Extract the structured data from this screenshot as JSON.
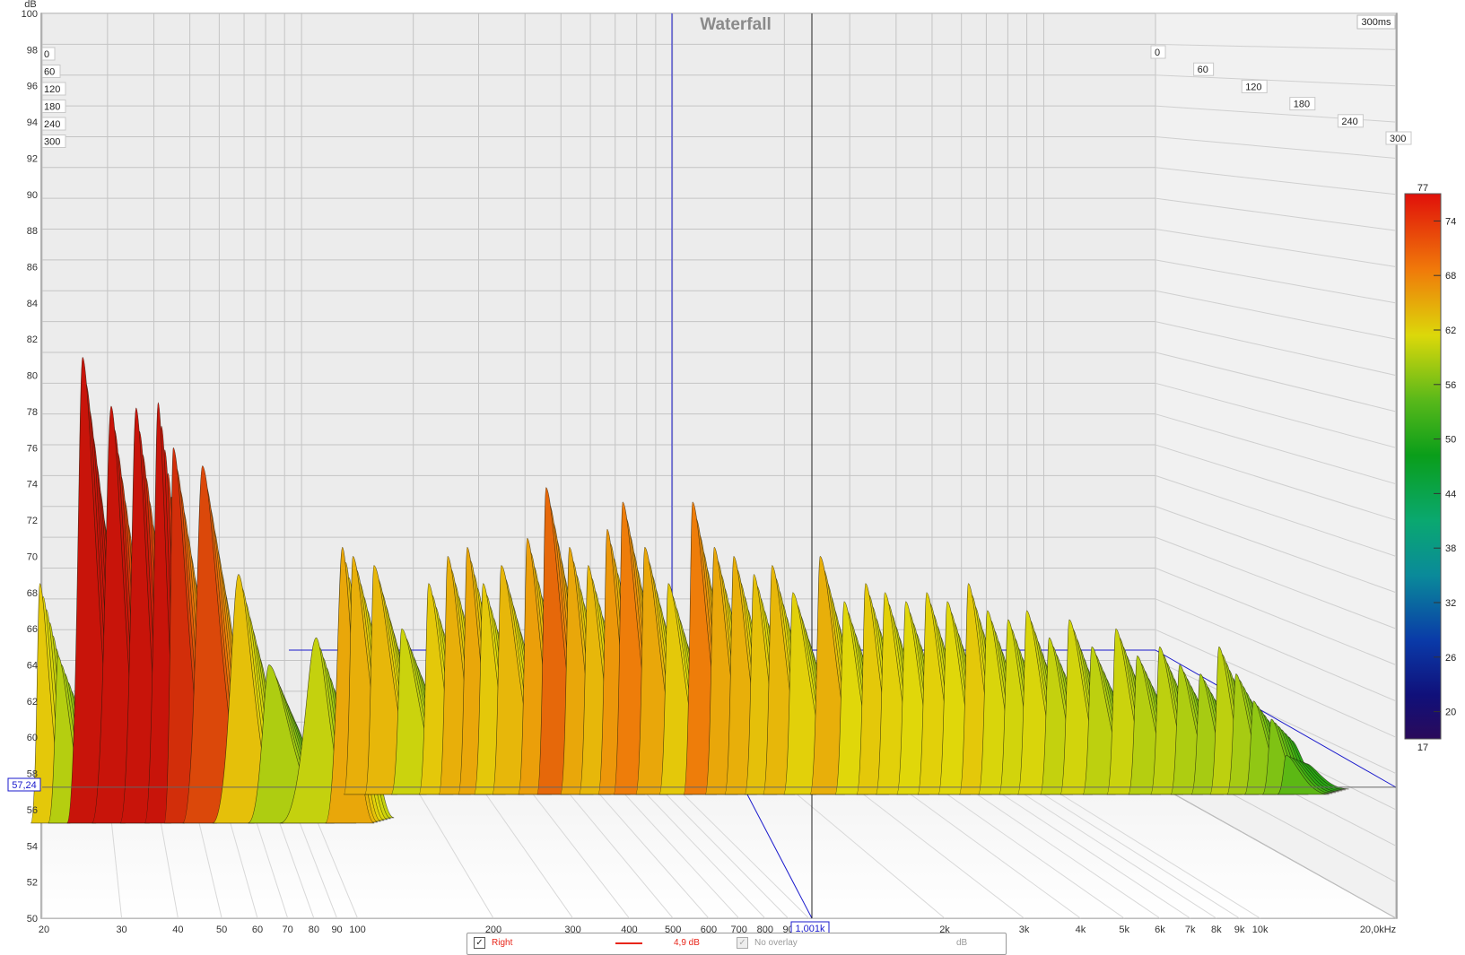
{
  "chart_data": {
    "type": "waterfall",
    "title": "Waterfall",
    "time_corner_label": "300ms",
    "y_unit_label": "dB",
    "y_ticks": [
      "50",
      "52",
      "54",
      "56",
      "58",
      "60",
      "62",
      "64",
      "66",
      "68",
      "70",
      "72",
      "74",
      "76",
      "78",
      "80",
      "82",
      "84",
      "86",
      "88",
      "90",
      "92",
      "94",
      "96",
      "98",
      "100"
    ],
    "ylim": [
      50,
      100
    ],
    "x_scale": "log",
    "xlim_hz": [
      20,
      20000
    ],
    "x_ticks": [
      {
        "hz": 20,
        "label": "20"
      },
      {
        "hz": 30,
        "label": "30"
      },
      {
        "hz": 40,
        "label": "40"
      },
      {
        "hz": 50,
        "label": "50"
      },
      {
        "hz": 60,
        "label": "60"
      },
      {
        "hz": 70,
        "label": "70"
      },
      {
        "hz": 80,
        "label": "80"
      },
      {
        "hz": 90,
        "label": "90"
      },
      {
        "hz": 100,
        "label": "100"
      },
      {
        "hz": 200,
        "label": "200"
      },
      {
        "hz": 300,
        "label": "300"
      },
      {
        "hz": 400,
        "label": "400"
      },
      {
        "hz": 500,
        "label": "500"
      },
      {
        "hz": 600,
        "label": "600"
      },
      {
        "hz": 700,
        "label": "700"
      },
      {
        "hz": 800,
        "label": "800"
      },
      {
        "hz": 900,
        "label": "90"
      },
      {
        "hz": 2000,
        "label": "2k"
      },
      {
        "hz": 3000,
        "label": "3k"
      },
      {
        "hz": 4000,
        "label": "4k"
      },
      {
        "hz": 5000,
        "label": "5k"
      },
      {
        "hz": 6000,
        "label": "6k"
      },
      {
        "hz": 7000,
        "label": "7k"
      },
      {
        "hz": 8000,
        "label": "8k"
      },
      {
        "hz": 9000,
        "label": "9k"
      },
      {
        "hz": 10000,
        "label": "10k"
      },
      {
        "hz": 20000,
        "label": "20,0kHz"
      }
    ],
    "cursor": {
      "freq_label": "1,001k",
      "level_label": "57,24"
    },
    "time_ticks_ms": [
      "0",
      "60",
      "120",
      "180",
      "240",
      "300"
    ],
    "left_time_ticks": [
      "0",
      "60",
      "120",
      "180",
      "240",
      "300"
    ],
    "colorbar": {
      "min": 17,
      "max": 77,
      "ticks": [
        "74",
        "68",
        "62",
        "56",
        "50",
        "44",
        "38",
        "32",
        "26",
        "20"
      ],
      "min_label": "17",
      "max_label": "77"
    },
    "peaks": [
      {
        "hz": 20.5,
        "db": 68.5
      },
      {
        "hz": 22.5,
        "db": 64.5
      },
      {
        "hz": 25.5,
        "db": 81.0
      },
      {
        "hz": 29.5,
        "db": 78.3
      },
      {
        "hz": 33.5,
        "db": 78.2
      },
      {
        "hz": 37.5,
        "db": 78.5
      },
      {
        "hz": 40.5,
        "db": 76.0
      },
      {
        "hz": 47.0,
        "db": 75.0
      },
      {
        "hz": 56.5,
        "db": 69.0
      },
      {
        "hz": 66.0,
        "db": 64.0
      },
      {
        "hz": 84.0,
        "db": 65.5
      },
      {
        "hz": 96.0,
        "db": 70.5
      },
      {
        "hz": 106.0,
        "db": 70.0
      },
      {
        "hz": 118.0,
        "db": 69.5
      },
      {
        "hz": 136.0,
        "db": 66.0
      },
      {
        "hz": 156.0,
        "db": 68.5
      },
      {
        "hz": 172.0,
        "db": 70.0
      },
      {
        "hz": 190.0,
        "db": 70.5
      },
      {
        "hz": 206.0,
        "db": 68.5
      },
      {
        "hz": 226.0,
        "db": 69.5
      },
      {
        "hz": 258.0,
        "db": 71.0
      },
      {
        "hz": 284.0,
        "db": 73.8
      },
      {
        "hz": 320.0,
        "db": 70.5
      },
      {
        "hz": 352.0,
        "db": 69.5
      },
      {
        "hz": 388.0,
        "db": 71.5
      },
      {
        "hz": 420.0,
        "db": 73.0
      },
      {
        "hz": 470.0,
        "db": 70.5
      },
      {
        "hz": 530.0,
        "db": 68.5
      },
      {
        "hz": 600.0,
        "db": 73.0
      },
      {
        "hz": 670.0,
        "db": 70.5
      },
      {
        "hz": 740.0,
        "db": 70.0
      },
      {
        "hz": 820.0,
        "db": 69.0
      },
      {
        "hz": 900.0,
        "db": 69.5
      },
      {
        "hz": 1000.0,
        "db": 68.0
      },
      {
        "hz": 1150.0,
        "db": 70.0
      },
      {
        "hz": 1300.0,
        "db": 67.5
      },
      {
        "hz": 1450.0,
        "db": 68.5
      },
      {
        "hz": 1600.0,
        "db": 68.0
      },
      {
        "hz": 1780.0,
        "db": 67.5
      },
      {
        "hz": 1980.0,
        "db": 68.0
      },
      {
        "hz": 2200.0,
        "db": 67.5
      },
      {
        "hz": 2450.0,
        "db": 68.5
      },
      {
        "hz": 2700.0,
        "db": 67.0
      },
      {
        "hz": 3000.0,
        "db": 66.5
      },
      {
        "hz": 3300.0,
        "db": 67.0
      },
      {
        "hz": 3700.0,
        "db": 65.5
      },
      {
        "hz": 4100.0,
        "db": 66.5
      },
      {
        "hz": 4600.0,
        "db": 65.0
      },
      {
        "hz": 5200.0,
        "db": 66.0
      },
      {
        "hz": 5800.0,
        "db": 64.5
      },
      {
        "hz": 6500.0,
        "db": 65.0
      },
      {
        "hz": 7200.0,
        "db": 64.0
      },
      {
        "hz": 8000.0,
        "db": 63.5
      },
      {
        "hz": 8800.0,
        "db": 65.0
      },
      {
        "hz": 9600.0,
        "db": 63.5
      },
      {
        "hz": 10500.0,
        "db": 62.0
      },
      {
        "hz": 11500.0,
        "db": 61.0
      },
      {
        "hz": 12400.0,
        "db": 59.0
      }
    ]
  },
  "legend": {
    "right_checked": "✓",
    "right_label": "Right",
    "right_level": "4,9 dB",
    "overlay_checked": "✓",
    "overlay_label": "No overlay",
    "overlay_unit": "dB"
  },
  "colors": {
    "frame": "#999999",
    "grid": "#c8c8c8",
    "back_panel": "#ececec",
    "cursor": "#1a1acc",
    "series_right": "#e8261a"
  }
}
